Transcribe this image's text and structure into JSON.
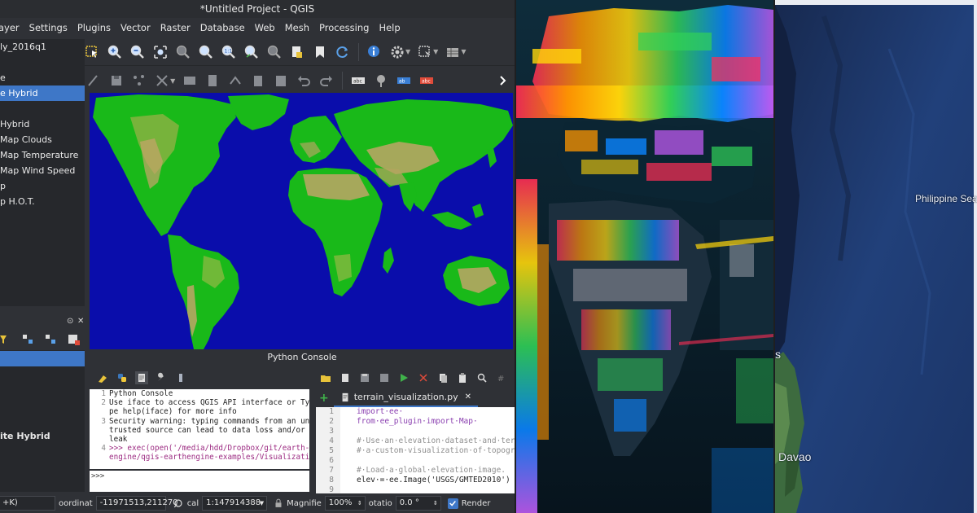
{
  "qgis": {
    "window_title": "*Untitled Project - QGIS",
    "menu": [
      "ayer",
      "Settings",
      "Plugins",
      "Vector",
      "Raster",
      "Database",
      "Web",
      "Mesh",
      "Processing",
      "Help"
    ],
    "browser_items": [
      "ly_2016q1",
      "",
      "e",
      "e Hybrid",
      "",
      "Hybrid",
      "Map Clouds",
      "Map Temperature",
      "Map Wind Speed",
      "p",
      "p H.O.T."
    ],
    "browser_selected_index": 3,
    "layers_items": [
      "",
      "",
      "",
      "",
      "",
      "ite Hybrid"
    ],
    "python_console": {
      "title": "Python Console",
      "output_lines": [
        {
          "n": "1",
          "text": "Python Console"
        },
        {
          "n": "2",
          "text": "Use iface to access QGIS API interface or Ty"
        },
        {
          "n": "",
          "text": "pe help(iface) for more info"
        },
        {
          "n": "3",
          "text": "Security warning: typing commands from an un"
        },
        {
          "n": "",
          "text": "trusted source can lead to data loss and/or"
        },
        {
          "n": "",
          "text": "leak"
        },
        {
          "n": "4",
          "text": ">>> exec(open('/media/hdd/Dropbox/git/earth-"
        },
        {
          "n": "",
          "text": "engine/qgis-earthengine-examples/Visualizati"
        }
      ],
      "prompt": ">>>",
      "editor_tab": "terrain_visualization.py",
      "editor_lines": [
        {
          "n": "1",
          "text": "import·ee·"
        },
        {
          "n": "2",
          "text": "from·ee_plugin·import·Map·"
        },
        {
          "n": "3",
          "text": ""
        },
        {
          "n": "4",
          "text": "#·Use·an·elevation·dataset·and·terrai"
        },
        {
          "n": "5",
          "text": "#·a·custom·visualization·of·topograph"
        },
        {
          "n": "6",
          "text": ""
        },
        {
          "n": "7",
          "text": "#·Load·a·global·elevation·image."
        },
        {
          "n": "8",
          "text": "elev·=·ee.Image('USGS/GMTED2010')"
        },
        {
          "n": "9",
          "text": ""
        }
      ]
    },
    "status": {
      "shortcut": "+K)",
      "coordinate_label": "oordinat",
      "coordinate_value": "-11971513,211270",
      "scale_label": "cal",
      "scale_value": "1:147914388",
      "magnifier_label": "Magnifie",
      "magnifier_value": "100%",
      "rotation_label": "otatio",
      "rotation_value": "0.0 °",
      "render_label": "Render"
    }
  },
  "satellite": {
    "labels": {
      "sea": "Philippine Sea",
      "city": "Davao",
      "partial": "s"
    }
  },
  "colors": {
    "accent": "#3e77c7",
    "ocean_map": "#0a0dab",
    "land_map": "#19b919",
    "sat_ocean": "#1e3566"
  }
}
